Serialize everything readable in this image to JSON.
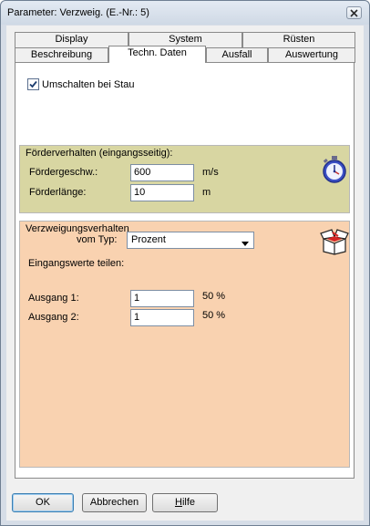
{
  "window": {
    "title": "Parameter: Verzweig. (E.-Nr.:  5)",
    "close_icon": "close-icon"
  },
  "tabs": {
    "row_top": [
      "Display",
      "System",
      "Rüsten"
    ],
    "row_bottom": [
      "Beschreibung",
      "Techn. Daten",
      "Ausfall",
      "Auswertung"
    ],
    "active": "Techn. Daten"
  },
  "options": {
    "umschalten_label": "Umschalten bei Stau",
    "umschalten_checked": true
  },
  "foerder": {
    "group_label": "Förderverhalten (eingangsseitig):",
    "speed_label": "Fördergeschw.:",
    "speed_value": "600",
    "speed_unit": "m/s",
    "length_label": "Förderlänge:",
    "length_value": "10",
    "length_unit": "m",
    "icon": "stopwatch-icon"
  },
  "verzweigung": {
    "group_label": "Verzweigungsverhalten",
    "type_label": "vom Typ:",
    "type_value": "Prozent",
    "split_label": "Eingangswerte teilen:",
    "icon": "box-icon",
    "outputs": [
      {
        "label": "Ausgang 1:",
        "value": "1",
        "percent": "50 %"
      },
      {
        "label": "Ausgang 2:",
        "value": "1",
        "percent": "50 %"
      }
    ]
  },
  "buttons": {
    "ok": "OK",
    "cancel": "Abbrechen",
    "help": "Hilfe"
  }
}
